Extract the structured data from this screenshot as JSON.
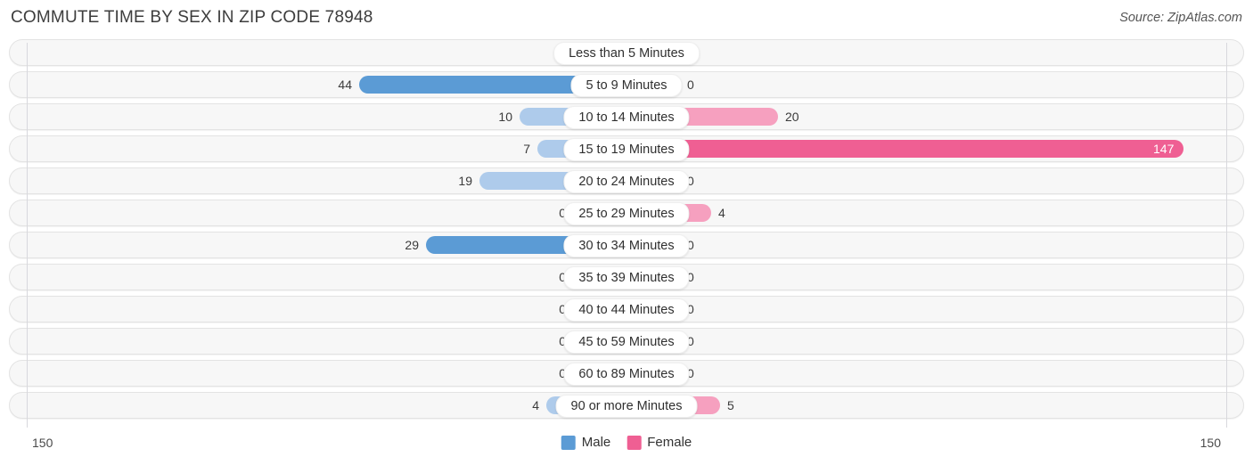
{
  "header": {
    "title": "COMMUTE TIME BY SEX IN ZIP CODE 78948",
    "source": "Source: ZipAtlas.com"
  },
  "legend": {
    "male": "Male",
    "female": "Female"
  },
  "axis": {
    "left_tick": "150",
    "right_tick": "150"
  },
  "colors": {
    "male": "#5b9bd5",
    "female": "#ef5f93",
    "male_light": "#aecbeb",
    "female_light": "#f6a0bf",
    "track": "#f7f7f7",
    "track_border": "#e3e3e3"
  },
  "chart_data": {
    "type": "bar",
    "title": "COMMUTE TIME BY SEX IN ZIP CODE 78948",
    "orientation": "horizontal-diverging",
    "xlabel": "",
    "ylabel": "",
    "xlim": [
      150,
      150
    ],
    "grid": false,
    "legend_position": "bottom-center",
    "categories": [
      "Less than 5 Minutes",
      "5 to 9 Minutes",
      "10 to 14 Minutes",
      "15 to 19 Minutes",
      "20 to 24 Minutes",
      "25 to 29 Minutes",
      "30 to 34 Minutes",
      "35 to 39 Minutes",
      "40 to 44 Minutes",
      "45 to 59 Minutes",
      "60 to 89 Minutes",
      "90 or more Minutes"
    ],
    "series": [
      {
        "name": "Male",
        "values": [
          0,
          44,
          10,
          7,
          19,
          0,
          29,
          0,
          0,
          0,
          0,
          4
        ]
      },
      {
        "name": "Female",
        "values": [
          0,
          0,
          20,
          147,
          0,
          4,
          0,
          0,
          0,
          0,
          0,
          5
        ]
      }
    ]
  },
  "rows": [
    {
      "label": "Less than 5 Minutes",
      "male": "0",
      "female": "0",
      "male_w": 60,
      "female_w": 60,
      "male_strong": false,
      "female_strong": false,
      "female_inside": false
    },
    {
      "label": "5 to 9 Minutes",
      "male": "44",
      "female": "0",
      "male_w": 300,
      "female_w": 60,
      "male_strong": true,
      "female_strong": false,
      "female_inside": false
    },
    {
      "label": "10 to 14 Minutes",
      "male": "10",
      "female": "20",
      "male_w": 120,
      "female_w": 170,
      "male_strong": false,
      "female_strong": false,
      "female_inside": false
    },
    {
      "label": "15 to 19 Minutes",
      "male": "7",
      "female": "147",
      "male_w": 100,
      "female_w": 625,
      "male_strong": false,
      "female_strong": true,
      "female_inside": true
    },
    {
      "label": "20 to 24 Minutes",
      "male": "19",
      "female": "0",
      "male_w": 165,
      "female_w": 60,
      "male_strong": false,
      "female_strong": false,
      "female_inside": false
    },
    {
      "label": "25 to 29 Minutes",
      "male": "0",
      "female": "4",
      "male_w": 60,
      "female_w": 95,
      "male_strong": false,
      "female_strong": false,
      "female_inside": false
    },
    {
      "label": "30 to 34 Minutes",
      "male": "29",
      "female": "0",
      "male_w": 225,
      "female_w": 60,
      "male_strong": true,
      "female_strong": false,
      "female_inside": false
    },
    {
      "label": "35 to 39 Minutes",
      "male": "0",
      "female": "0",
      "male_w": 60,
      "female_w": 60,
      "male_strong": false,
      "female_strong": false,
      "female_inside": false
    },
    {
      "label": "40 to 44 Minutes",
      "male": "0",
      "female": "0",
      "male_w": 60,
      "female_w": 60,
      "male_strong": false,
      "female_strong": false,
      "female_inside": false
    },
    {
      "label": "45 to 59 Minutes",
      "male": "0",
      "female": "0",
      "male_w": 60,
      "female_w": 60,
      "male_strong": false,
      "female_strong": false,
      "female_inside": false
    },
    {
      "label": "60 to 89 Minutes",
      "male": "0",
      "female": "0",
      "male_w": 60,
      "female_w": 60,
      "male_strong": false,
      "female_strong": false,
      "female_inside": false
    },
    {
      "label": "90 or more Minutes",
      "male": "4",
      "female": "5",
      "male_w": 90,
      "female_w": 105,
      "male_strong": false,
      "female_strong": false,
      "female_inside": false
    }
  ]
}
